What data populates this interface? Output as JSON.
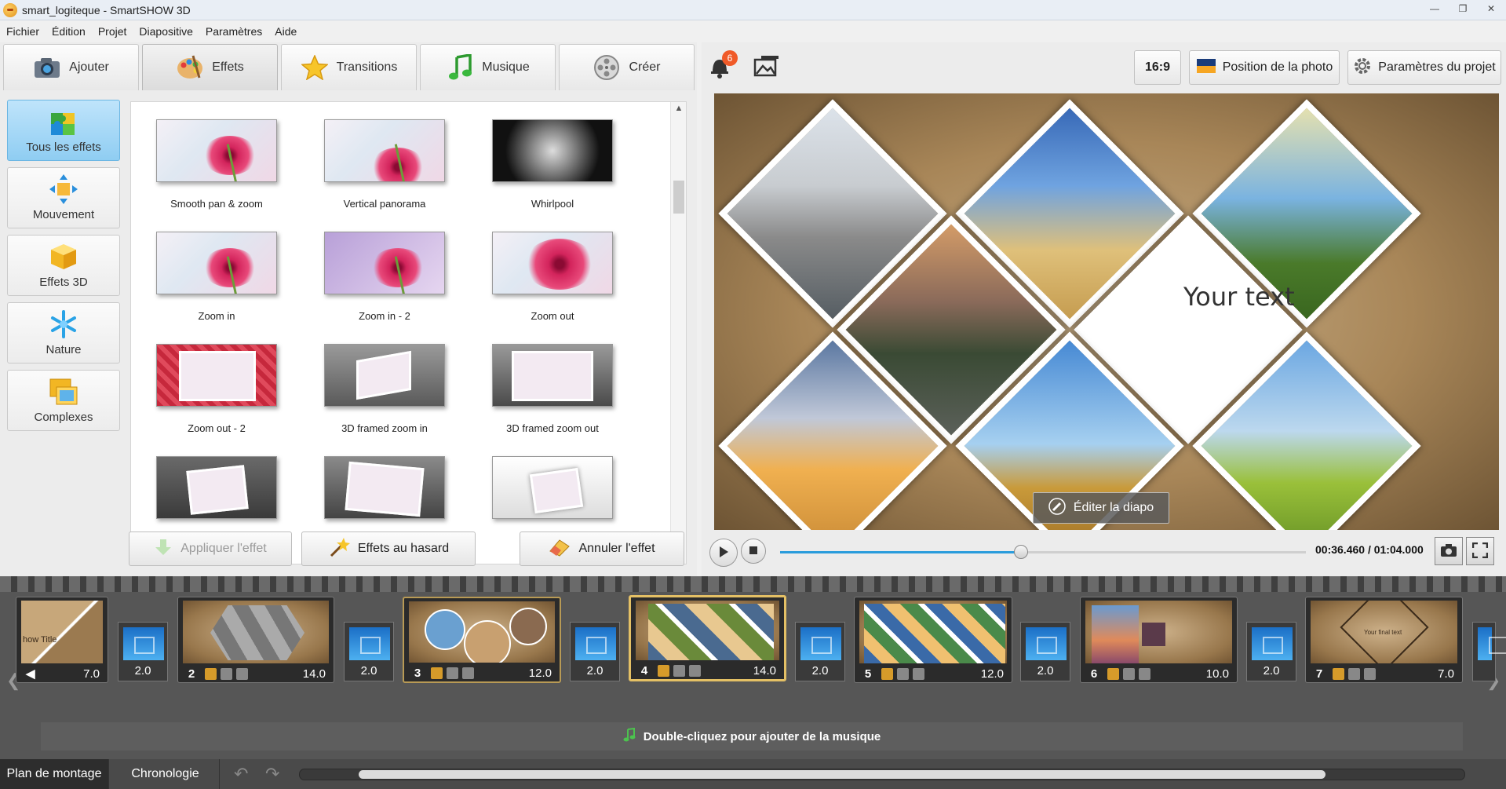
{
  "window": {
    "title": "smart_logiteque - SmartSHOW 3D"
  },
  "menu": [
    "Fichier",
    "Édition",
    "Projet",
    "Diapositive",
    "Paramètres",
    "Aide"
  ],
  "tabs": [
    {
      "label": "Ajouter",
      "icon": "camera-icon"
    },
    {
      "label": "Effets",
      "icon": "palette-icon"
    },
    {
      "label": "Transitions",
      "icon": "star-icon"
    },
    {
      "label": "Musique",
      "icon": "music-note-icon"
    },
    {
      "label": "Créer",
      "icon": "film-reel-icon"
    }
  ],
  "categories": [
    {
      "label": "Tous les effets",
      "icon": "puzzle-icon"
    },
    {
      "label": "Mouvement",
      "icon": "move-arrows-icon"
    },
    {
      "label": "Effets 3D",
      "icon": "cube-icon"
    },
    {
      "label": "Nature",
      "icon": "snowflake-icon"
    },
    {
      "label": "Complexes",
      "icon": "stacked-frames-icon"
    }
  ],
  "effects": [
    "Smooth pan & zoom",
    "Vertical panorama",
    "Whirlpool",
    "Zoom in",
    "Zoom in - 2",
    "Zoom out",
    "Zoom out - 2",
    "3D framed zoom in",
    "3D framed zoom out",
    "",
    "",
    ""
  ],
  "effect_buttons": {
    "apply": "Appliquer l'effet",
    "random": "Effets au hasard",
    "cancel": "Annuler l'effet"
  },
  "toolbar": {
    "notifications_count": "6",
    "aspect": "16:9",
    "photo_position": "Position de la photo",
    "project_settings": "Paramètres du projet"
  },
  "preview": {
    "overlay_text": "Your text",
    "edit_button": "Éditer la diapo"
  },
  "player": {
    "timecode": "00:36.460 / 01:04.000",
    "progress": 0.458
  },
  "slides": [
    {
      "num": "",
      "duration": "7.0",
      "caption": "how Title"
    },
    {
      "num": "2",
      "duration": "14.0"
    },
    {
      "num": "3",
      "duration": "12.0"
    },
    {
      "num": "4",
      "duration": "14.0"
    },
    {
      "num": "5",
      "duration": "12.0"
    },
    {
      "num": "6",
      "duration": "10.0"
    },
    {
      "num": "7",
      "duration": "7.0",
      "caption": "Your final text"
    }
  ],
  "transitions": [
    "2.0",
    "2.0",
    "2.0",
    "2.0",
    "2.0",
    "2.0"
  ],
  "music_hint": "Double-cliquez pour ajouter de la musique",
  "bottom_tabs": [
    "Plan de montage",
    "Chronologie"
  ],
  "colors": {
    "accent": "#2a9cdc",
    "selected_slide": "#e4c065",
    "category_active": "#8fcdf2"
  }
}
